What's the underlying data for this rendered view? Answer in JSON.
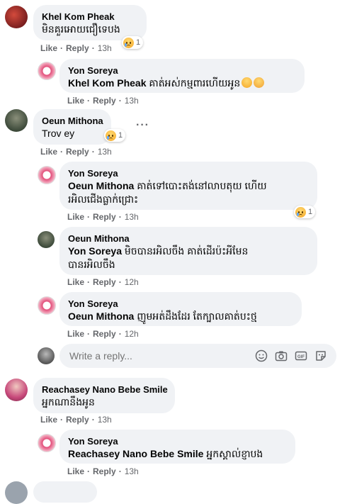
{
  "actions": {
    "like": "Like",
    "reply": "Reply"
  },
  "comments": [
    {
      "name": "Khel Kom Pheak",
      "text": "មិនគួរអោយជឿទេបង",
      "time": "13h",
      "reaction_count": "1"
    },
    {
      "name": "Yon Soreya",
      "mention": "Khel Kom Pheak",
      "text": "គាត់អស់កម្មពារហើយអូន",
      "time": "13h"
    },
    {
      "name": "Oeun Mithona",
      "text": "Trov ey",
      "time": "13h",
      "reaction_count": "1"
    },
    {
      "name": "Yon Soreya",
      "mention": "Oeun Mithona",
      "text_line1": "គាត់ទៅបោះតង់នៅលាបតុយ ហើយ",
      "text_line2": "រអិលជើងធ្លាក់ជ្រោះ",
      "time": "13h",
      "reaction_count": "1"
    },
    {
      "name": "Oeun Mithona",
      "mention": "Yon Soreya",
      "text_line1": "មិចបានរអិលចឹង គាត់ដើរប៉ះអីមែន",
      "text_line2": "បានរអិលចឹង",
      "time": "12h"
    },
    {
      "name": "Yon Soreya",
      "mention": "Oeun Mithona",
      "text": "ញូមអត់ដឹងដែរ តែក្បាលគាត់បះថ្ម",
      "time": "12h"
    },
    {
      "name": "Reachasey Nano Bebe Smile",
      "text": "អ្នកណានឹងអូន",
      "time": "13h"
    },
    {
      "name": "Yon Soreya",
      "mention": "Reachasey Nano Bebe Smile",
      "text": "អ្នកស្គាល់ខ្ញាបង",
      "time": "13h"
    }
  ],
  "reply_box": {
    "placeholder": "Write a reply..."
  },
  "icons": [
    "sad-emoji-icon",
    "crying-emoji-icon",
    "more-options-icon",
    "emoji-icon",
    "camera-icon",
    "gif-icon",
    "sticker-icon"
  ],
  "colors": {
    "bubble": "#f0f2f5",
    "meta_text": "#65676b"
  }
}
